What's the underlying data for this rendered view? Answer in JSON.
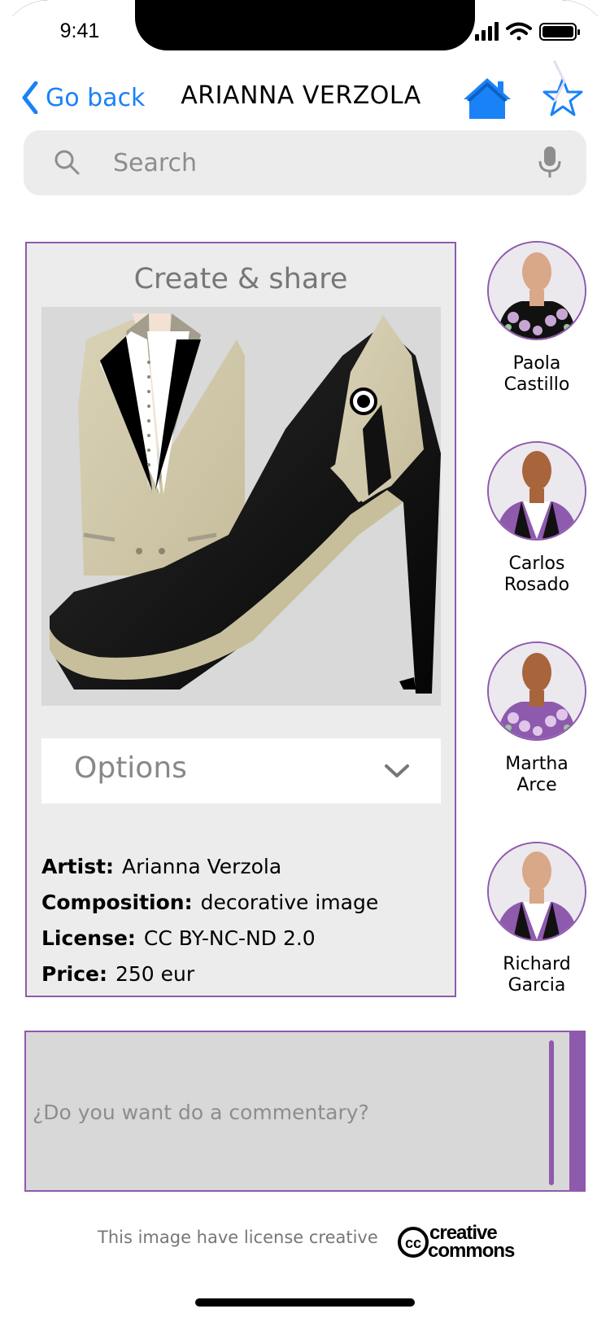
{
  "status_bar": {
    "time": "9:41"
  },
  "header": {
    "back_label": "Go back",
    "title": "ARIANNA VERZOLA"
  },
  "search": {
    "placeholder": "Search"
  },
  "card": {
    "title": "Create & share",
    "options_label": "Options",
    "meta": [
      {
        "key": "Artist:",
        "value": "Arianna Verzola"
      },
      {
        "key": "Composition:",
        "value": "decorative image"
      },
      {
        "key": "License:",
        "value": "CC BY-NC-ND 2.0"
      },
      {
        "key": "Price:",
        "value": "250 eur"
      }
    ]
  },
  "artists": [
    {
      "first": "Paola",
      "last": "Castillo"
    },
    {
      "first": "Carlos",
      "last": "Rosado"
    },
    {
      "first": "Martha",
      "last": "Arce"
    },
    {
      "first": "Richard",
      "last": "Garcia"
    }
  ],
  "comment": {
    "placeholder": "¿Do you want do a commentary?"
  },
  "footer": {
    "license_text": "This image have license creative",
    "cc_logo_line1": "creative",
    "cc_logo_line2": "commons"
  },
  "colors": {
    "accent": "#8e5aad",
    "link": "#1a82f7",
    "panel": "#ececec"
  }
}
